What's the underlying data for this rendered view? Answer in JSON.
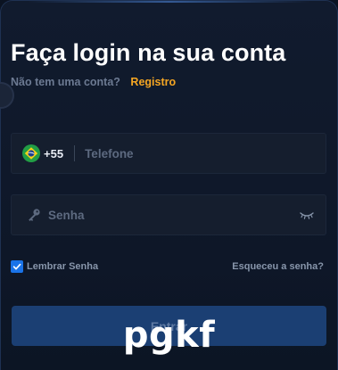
{
  "login": {
    "title": "Faça login na sua conta",
    "no_account_text": "Não tem uma conta?",
    "register_link": "Registro",
    "phone": {
      "country_flag": "brazil-flag-icon",
      "country_code": "+55",
      "placeholder": "Telefone",
      "value": ""
    },
    "password": {
      "icon": "key-icon",
      "placeholder": "Senha",
      "value": "",
      "toggle_icon": "eye-closed-icon"
    },
    "remember_me": {
      "label": "Lembrar Senha",
      "checked": true
    },
    "forgot_password": "Esqueceu a senha?",
    "submit_label": "Entrar"
  },
  "watermark": "pgkf",
  "colors": {
    "background": "#0b1322",
    "panel": "#111b2e",
    "field": "#151e2e",
    "accent_link": "#f5a623",
    "checkbox": "#1a73e8",
    "button": "#1b3f73",
    "title_text": "#ffffff",
    "muted_text": "#6c7a92"
  }
}
